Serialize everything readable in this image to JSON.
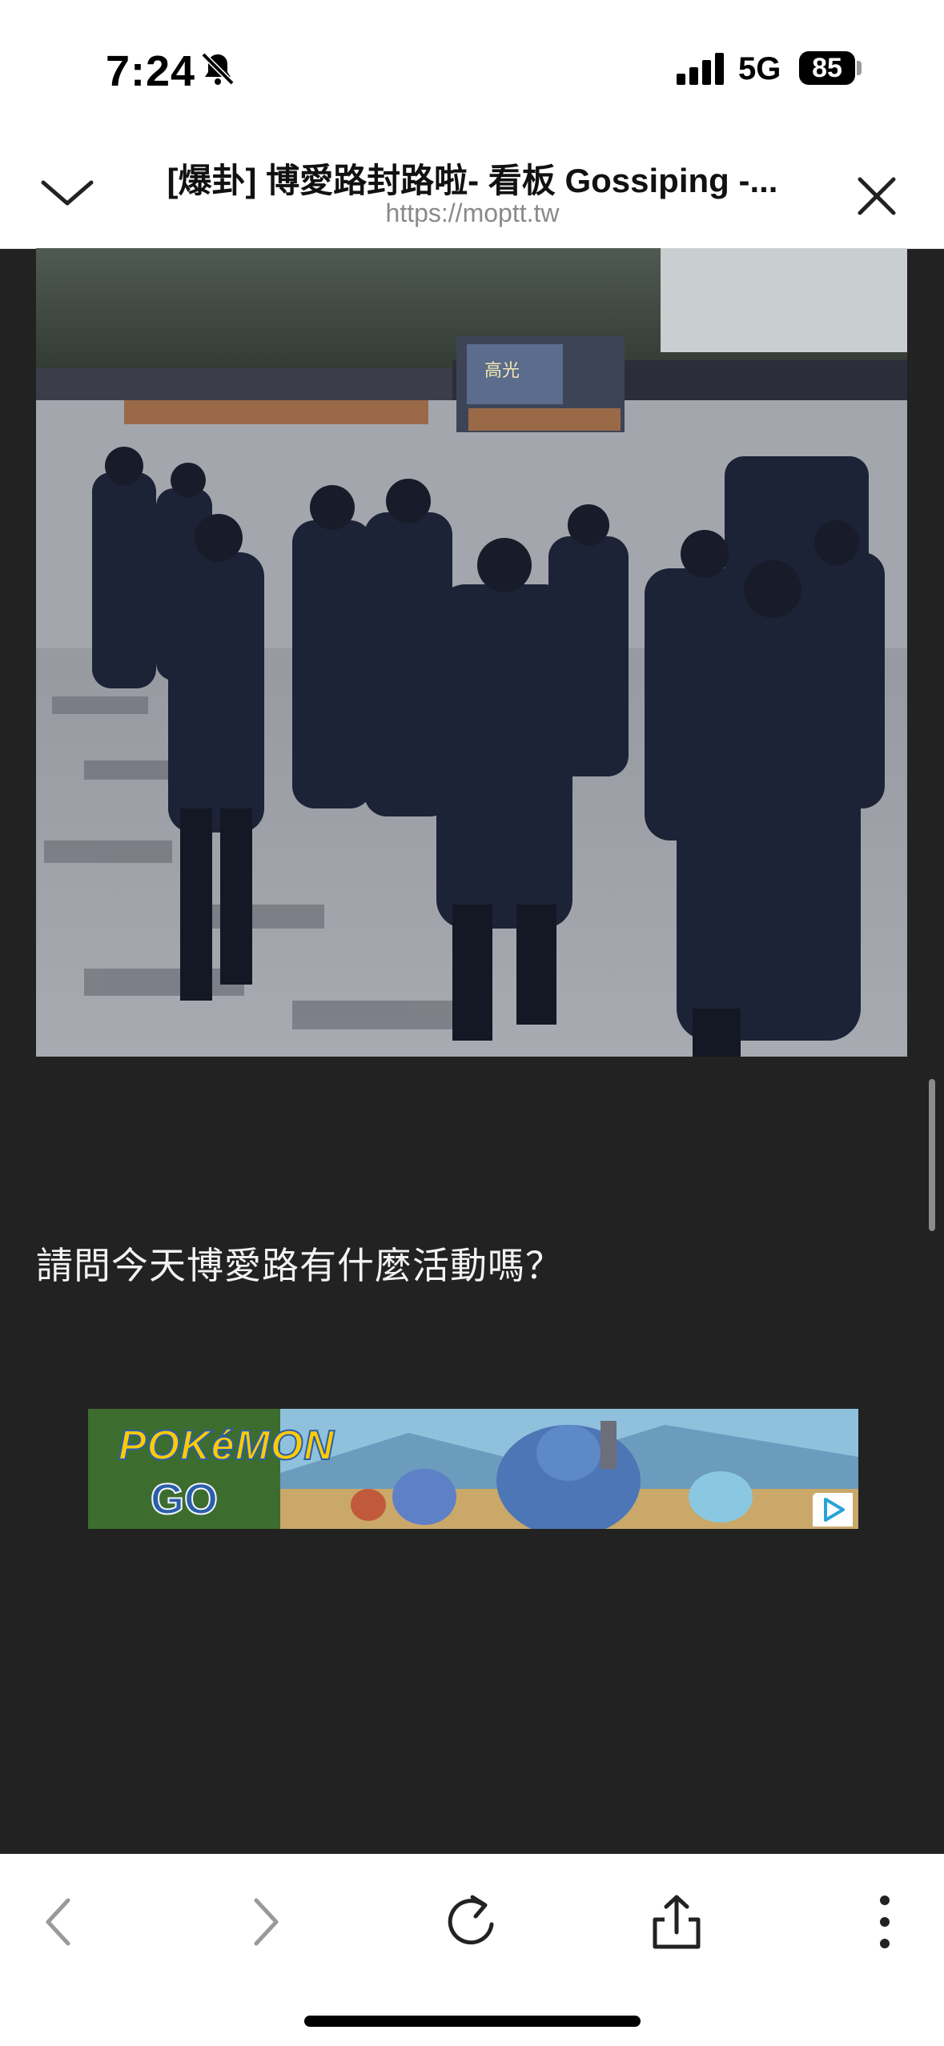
{
  "status": {
    "time": "7:24",
    "network": "5G",
    "battery": "85"
  },
  "browser": {
    "title": "[爆卦] 博愛路封路啦- 看板 Gossiping -...",
    "url": "https://moptt.tw"
  },
  "article": {
    "question": "請問今天博愛路有什麼活動嗎？",
    "photo_sign": "高光"
  },
  "ad": {
    "brand_line1": "POKéMON",
    "brand_line2": "GO"
  },
  "colors": {
    "background": "#222222",
    "chrome": "#ffffff",
    "text": "#f2f2f2",
    "url": "#8a8a8a"
  }
}
